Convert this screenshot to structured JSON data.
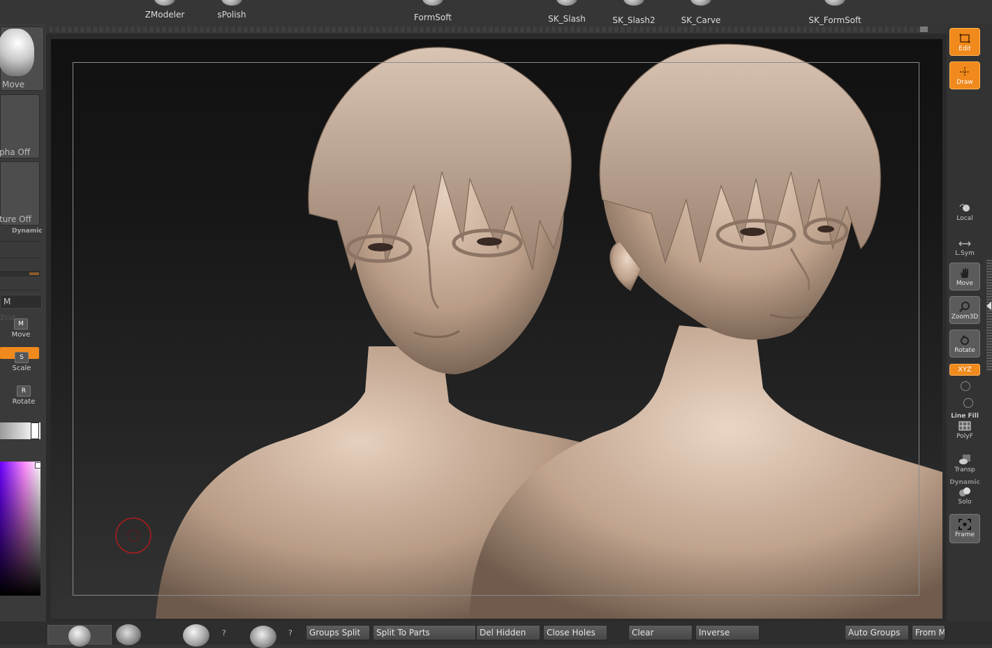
{
  "top_shelf": {
    "brushes": [
      "ZModeler",
      "sPolish",
      "FormSoft",
      "SK_Slash",
      "SK_Slash2",
      "SK_Carve",
      "SK_FormSoft"
    ]
  },
  "left_tray": {
    "brush_label": "Move",
    "alpha_label": "pha Off",
    "texture_label": "ture Off",
    "dynamic_label": "Dynamic",
    "mat_label": "M",
    "zcut_label": "Zcut",
    "move_label": "Move",
    "scale_label": "Scale",
    "rotate_label": "Rotate",
    "move_icon": "M",
    "scale_icon": "S",
    "rotate_icon": "R"
  },
  "right_tray": {
    "edit": "Edit",
    "draw": "Draw",
    "local": "Local",
    "lsym": "L.Sym",
    "move": "Move",
    "zoom3d": "Zoom3D",
    "rotate": "Rotate",
    "xyz": "XYZ",
    "linefill": "Line Fill",
    "polyf": "PolyF",
    "transp": "Transp",
    "dynamic": "Dynamic",
    "solo": "Solo",
    "frame": "Frame"
  },
  "bottom_bar": {
    "questions": [
      "?",
      "?"
    ],
    "buttons": [
      "Groups Split",
      "Split To Parts",
      "Del Hidden",
      "Close Holes",
      "Clear",
      "Inverse",
      "Auto Groups",
      "From M"
    ]
  },
  "colors": {
    "accent_orange": "#f08a1c",
    "skin": "#c9ad96",
    "brush_cursor": "#b01c1c"
  }
}
